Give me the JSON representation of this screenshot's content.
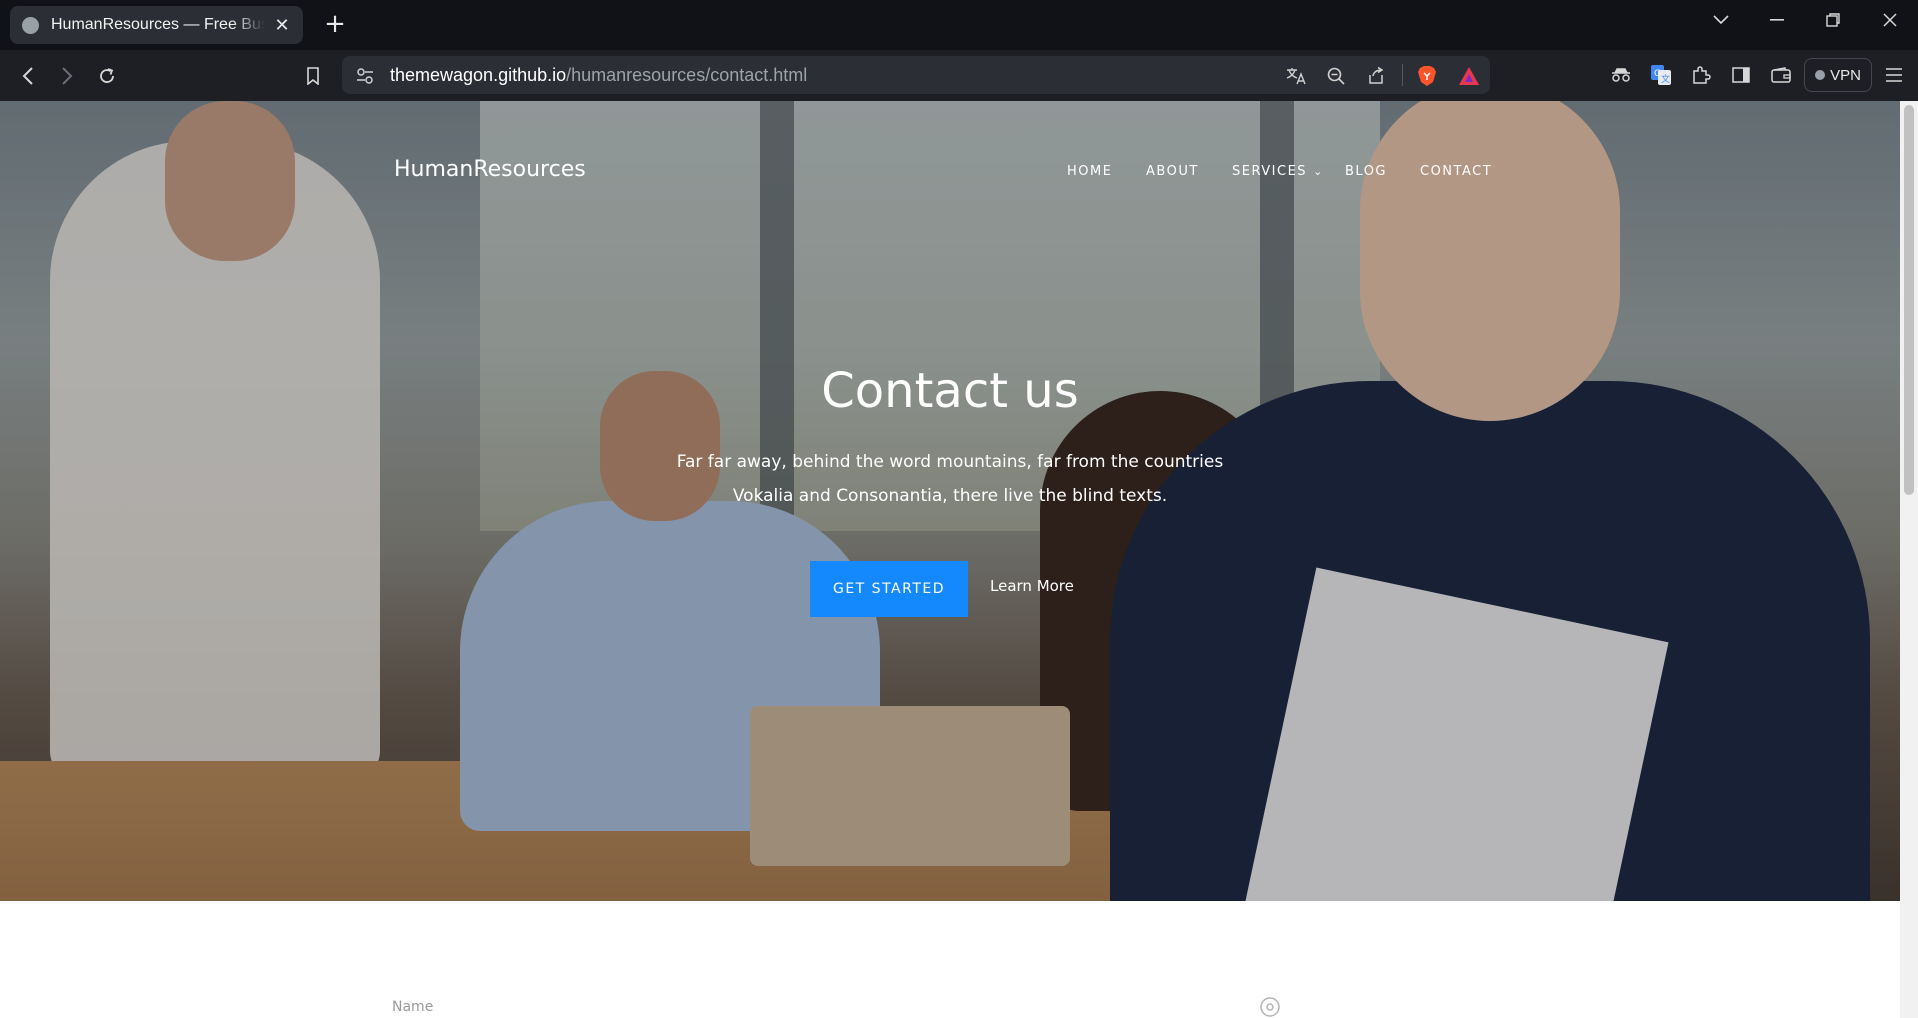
{
  "browser": {
    "tab_title": "HumanResources — Free Business",
    "tab_close": "✕",
    "new_tab": "+",
    "url_host": "themewagon.github.io",
    "url_path": "/humanresources/contact.html",
    "vpn_label": "VPN",
    "icons": {
      "back": "back-icon",
      "forward": "forward-icon",
      "reload": "reload-icon",
      "bookmark": "bookmark-icon",
      "site_info": "site-settings-icon",
      "translate": "translate-icon",
      "zoom": "zoom-out-icon",
      "share": "share-icon",
      "brave_shield": "brave-shield-icon",
      "brave_rewards": "brave-rewards-icon",
      "incognito": "private-window-icon",
      "google_translate": "google-translate-icon",
      "extensions": "extensions-icon",
      "sidebar": "sidebar-icon",
      "wallet": "wallet-icon",
      "menu": "menu-icon",
      "tab_list": "tab-search-icon",
      "minimize": "minimize-icon",
      "restore": "restore-icon",
      "close_window": "close-window-icon"
    }
  },
  "site": {
    "brand": "HumanResources",
    "nav": [
      {
        "label": "HOME"
      },
      {
        "label": "ABOUT"
      },
      {
        "label": "SERVICES",
        "has_dropdown": true
      },
      {
        "label": "BLOG"
      },
      {
        "label": "CONTACT"
      }
    ],
    "hero": {
      "title": "Contact us",
      "subtitle": "Far far away, behind the word mountains, far from the countries Vokalia and Consonantia, there live the blind texts.",
      "primary_button": "GET STARTED",
      "secondary_link": "Learn More"
    },
    "form": {
      "name_label": "Name"
    }
  },
  "colors": {
    "accent": "#1389fd",
    "tabbar": "#101217",
    "toolbar": "#1d1f24"
  }
}
